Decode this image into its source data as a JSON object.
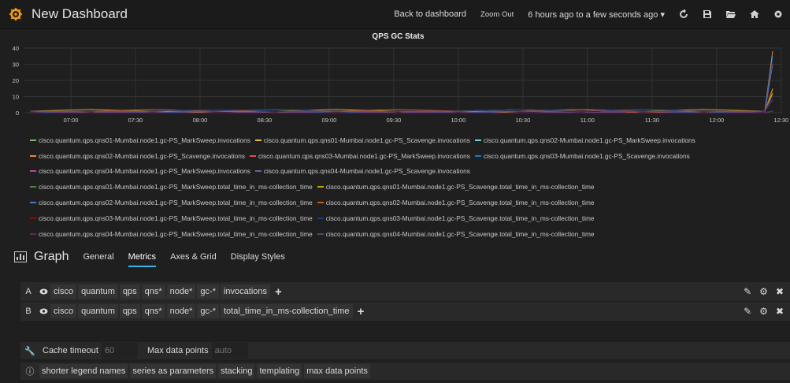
{
  "header": {
    "title": "New Dashboard",
    "back_label": "Back to dashboard",
    "zoom_label": "Zoom Out",
    "time_range": "6 hours ago to a few seconds ago ▾"
  },
  "colors": {
    "accent": "#33b5e5",
    "background": "#1f1f1f",
    "series": [
      "#7eb26d",
      "#eab839",
      "#6ed0e0",
      "#ef843c",
      "#e24d42",
      "#1f78c1",
      "#ba43a9",
      "#705da0",
      "#508642",
      "#cca300",
      "#447ebc",
      "#c15c17",
      "#890f02",
      "#0a437c",
      "#6d1f62",
      "#584477"
    ]
  },
  "chart_data": {
    "type": "line",
    "title": "QPS GC Stats",
    "ylim": [
      0,
      40
    ],
    "yticks": [
      0,
      10,
      20,
      30,
      40
    ],
    "xticks": [
      "07:00",
      "07:30",
      "08:00",
      "08:30",
      "09:00",
      "09:30",
      "10:00",
      "10:30",
      "11:00",
      "11:30",
      "12:00",
      "12:30"
    ],
    "series": [
      {
        "name": "cisco.quantum.qps.qns01-Mumbai.node1.gc-PS_MarkSweep.invocations",
        "values": [
          0,
          0,
          0,
          0,
          0,
          0,
          0,
          0,
          0,
          0,
          0,
          0,
          0,
          1
        ]
      },
      {
        "name": "cisco.quantum.qps.qns01-Mumbai.node1.gc-PS_Scavenge.invocations",
        "values": [
          1,
          0,
          1,
          0,
          0,
          1,
          0,
          1,
          0,
          0,
          1,
          0,
          1,
          12
        ]
      },
      {
        "name": "cisco.quantum.qps.qns02-Mumbai.node1.gc-PS_MarkSweep.invocations",
        "values": [
          0,
          0,
          0,
          0,
          0,
          0,
          0,
          0,
          0,
          0,
          0,
          0,
          0,
          1
        ]
      },
      {
        "name": "cisco.quantum.qps.qns02-Mumbai.node1.gc-PS_Scavenge.invocations",
        "values": [
          1,
          1,
          0,
          1,
          0,
          1,
          1,
          0,
          1,
          2,
          0,
          1,
          1,
          38
        ]
      },
      {
        "name": "cisco.quantum.qps.qns03-Mumbai.node1.gc-PS_MarkSweep.invocations",
        "values": [
          0,
          0,
          0,
          0,
          0,
          0,
          0,
          0,
          0,
          0,
          0,
          0,
          0,
          1
        ]
      },
      {
        "name": "cisco.quantum.qps.qns03-Mumbai.node1.gc-PS_Scavenge.invocations",
        "values": [
          0,
          1,
          0,
          1,
          1,
          0,
          1,
          0,
          1,
          0,
          1,
          0,
          1,
          35
        ]
      },
      {
        "name": "cisco.quantum.qps.qns04-Mumbai.node1.gc-PS_MarkSweep.invocations",
        "values": [
          0,
          0,
          0,
          0,
          0,
          0,
          0,
          0,
          0,
          0,
          0,
          0,
          0,
          1
        ]
      },
      {
        "name": "cisco.quantum.qps.qns04-Mumbai.node1.gc-PS_Scavenge.invocations",
        "values": [
          1,
          0,
          1,
          1,
          0,
          1,
          0,
          1,
          1,
          0,
          1,
          1,
          0,
          30
        ]
      },
      {
        "name": "cisco.quantum.qps.qns01-Mumbai.node1.gc-PS_MarkSweep.total_time_in_ms-collection_time",
        "values": [
          0,
          0,
          0,
          0,
          0,
          0,
          0,
          0,
          0,
          0,
          0,
          0,
          0,
          1
        ]
      },
      {
        "name": "cisco.quantum.qps.qns01-Mumbai.node1.gc-PS_Scavenge.total_time_in_ms-collection_time",
        "values": [
          1,
          2,
          1,
          1,
          1,
          2,
          1,
          1,
          2,
          1,
          1,
          2,
          1,
          15
        ]
      },
      {
        "name": "cisco.quantum.qps.qns02-Mumbai.node1.gc-PS_MarkSweep.total_time_in_ms-collection_time",
        "values": [
          0,
          0,
          0,
          0,
          0,
          0,
          0,
          0,
          0,
          0,
          0,
          0,
          0,
          1
        ]
      },
      {
        "name": "cisco.quantum.qps.qns02-Mumbai.node1.gc-PS_Scavenge.total_time_in_ms-collection_time",
        "values": [
          1,
          1,
          2,
          1,
          1,
          1,
          2,
          1,
          1,
          2,
          1,
          1,
          1,
          14
        ]
      },
      {
        "name": "cisco.quantum.qps.qns03-Mumbai.node1.gc-PS_MarkSweep.total_time_in_ms-collection_time",
        "values": [
          0,
          0,
          0,
          0,
          0,
          0,
          0,
          0,
          0,
          0,
          0,
          0,
          0,
          1
        ]
      },
      {
        "name": "cisco.quantum.qps.qns03-Mumbai.node1.gc-PS_Scavenge.total_time_in_ms-collection_time",
        "values": [
          1,
          1,
          1,
          2,
          1,
          1,
          1,
          1,
          2,
          1,
          1,
          1,
          1,
          10
        ]
      },
      {
        "name": "cisco.quantum.qps.qns04-Mumbai.node1.gc-PS_MarkSweep.total_time_in_ms-collection_time",
        "values": [
          0,
          0,
          0,
          0,
          0,
          0,
          0,
          0,
          0,
          0,
          0,
          0,
          0,
          1
        ]
      },
      {
        "name": "cisco.quantum.qps.qns04-Mumbai.node1.gc-PS_Scavenge.total_time_in_ms-collection_time",
        "values": [
          1,
          1,
          1,
          1,
          2,
          1,
          1,
          1,
          1,
          1,
          2,
          1,
          1,
          8
        ]
      }
    ],
    "legend_rows": [
      [
        0,
        1,
        2
      ],
      [
        3,
        4,
        5
      ],
      [
        6,
        7
      ],
      [
        8,
        9
      ],
      [
        10,
        11
      ],
      [
        12,
        13
      ],
      [
        14,
        15
      ]
    ],
    "grid": true,
    "legend_position": "bottom"
  },
  "editor": {
    "title": "Graph",
    "tabs": [
      "General",
      "Metrics",
      "Axes & Grid",
      "Display Styles"
    ],
    "queries": [
      {
        "letter": "A",
        "segments": [
          "cisco",
          "quantum",
          "qps",
          "qns*",
          "node*",
          "gc-*",
          "invocations"
        ]
      },
      {
        "letter": "B",
        "segments": [
          "cisco",
          "quantum",
          "qps",
          "qns*",
          "node*",
          "gc-*",
          "total_time_in_ms-collection_time"
        ]
      }
    ],
    "options": {
      "cache_label": "Cache timeout",
      "cache_placeholder": "60",
      "maxdp_label": "Max data points",
      "maxdp_placeholder": "auto",
      "help_links": [
        "shorter legend names",
        "series as parameters",
        "stacking",
        "templating",
        "max data points"
      ]
    }
  }
}
